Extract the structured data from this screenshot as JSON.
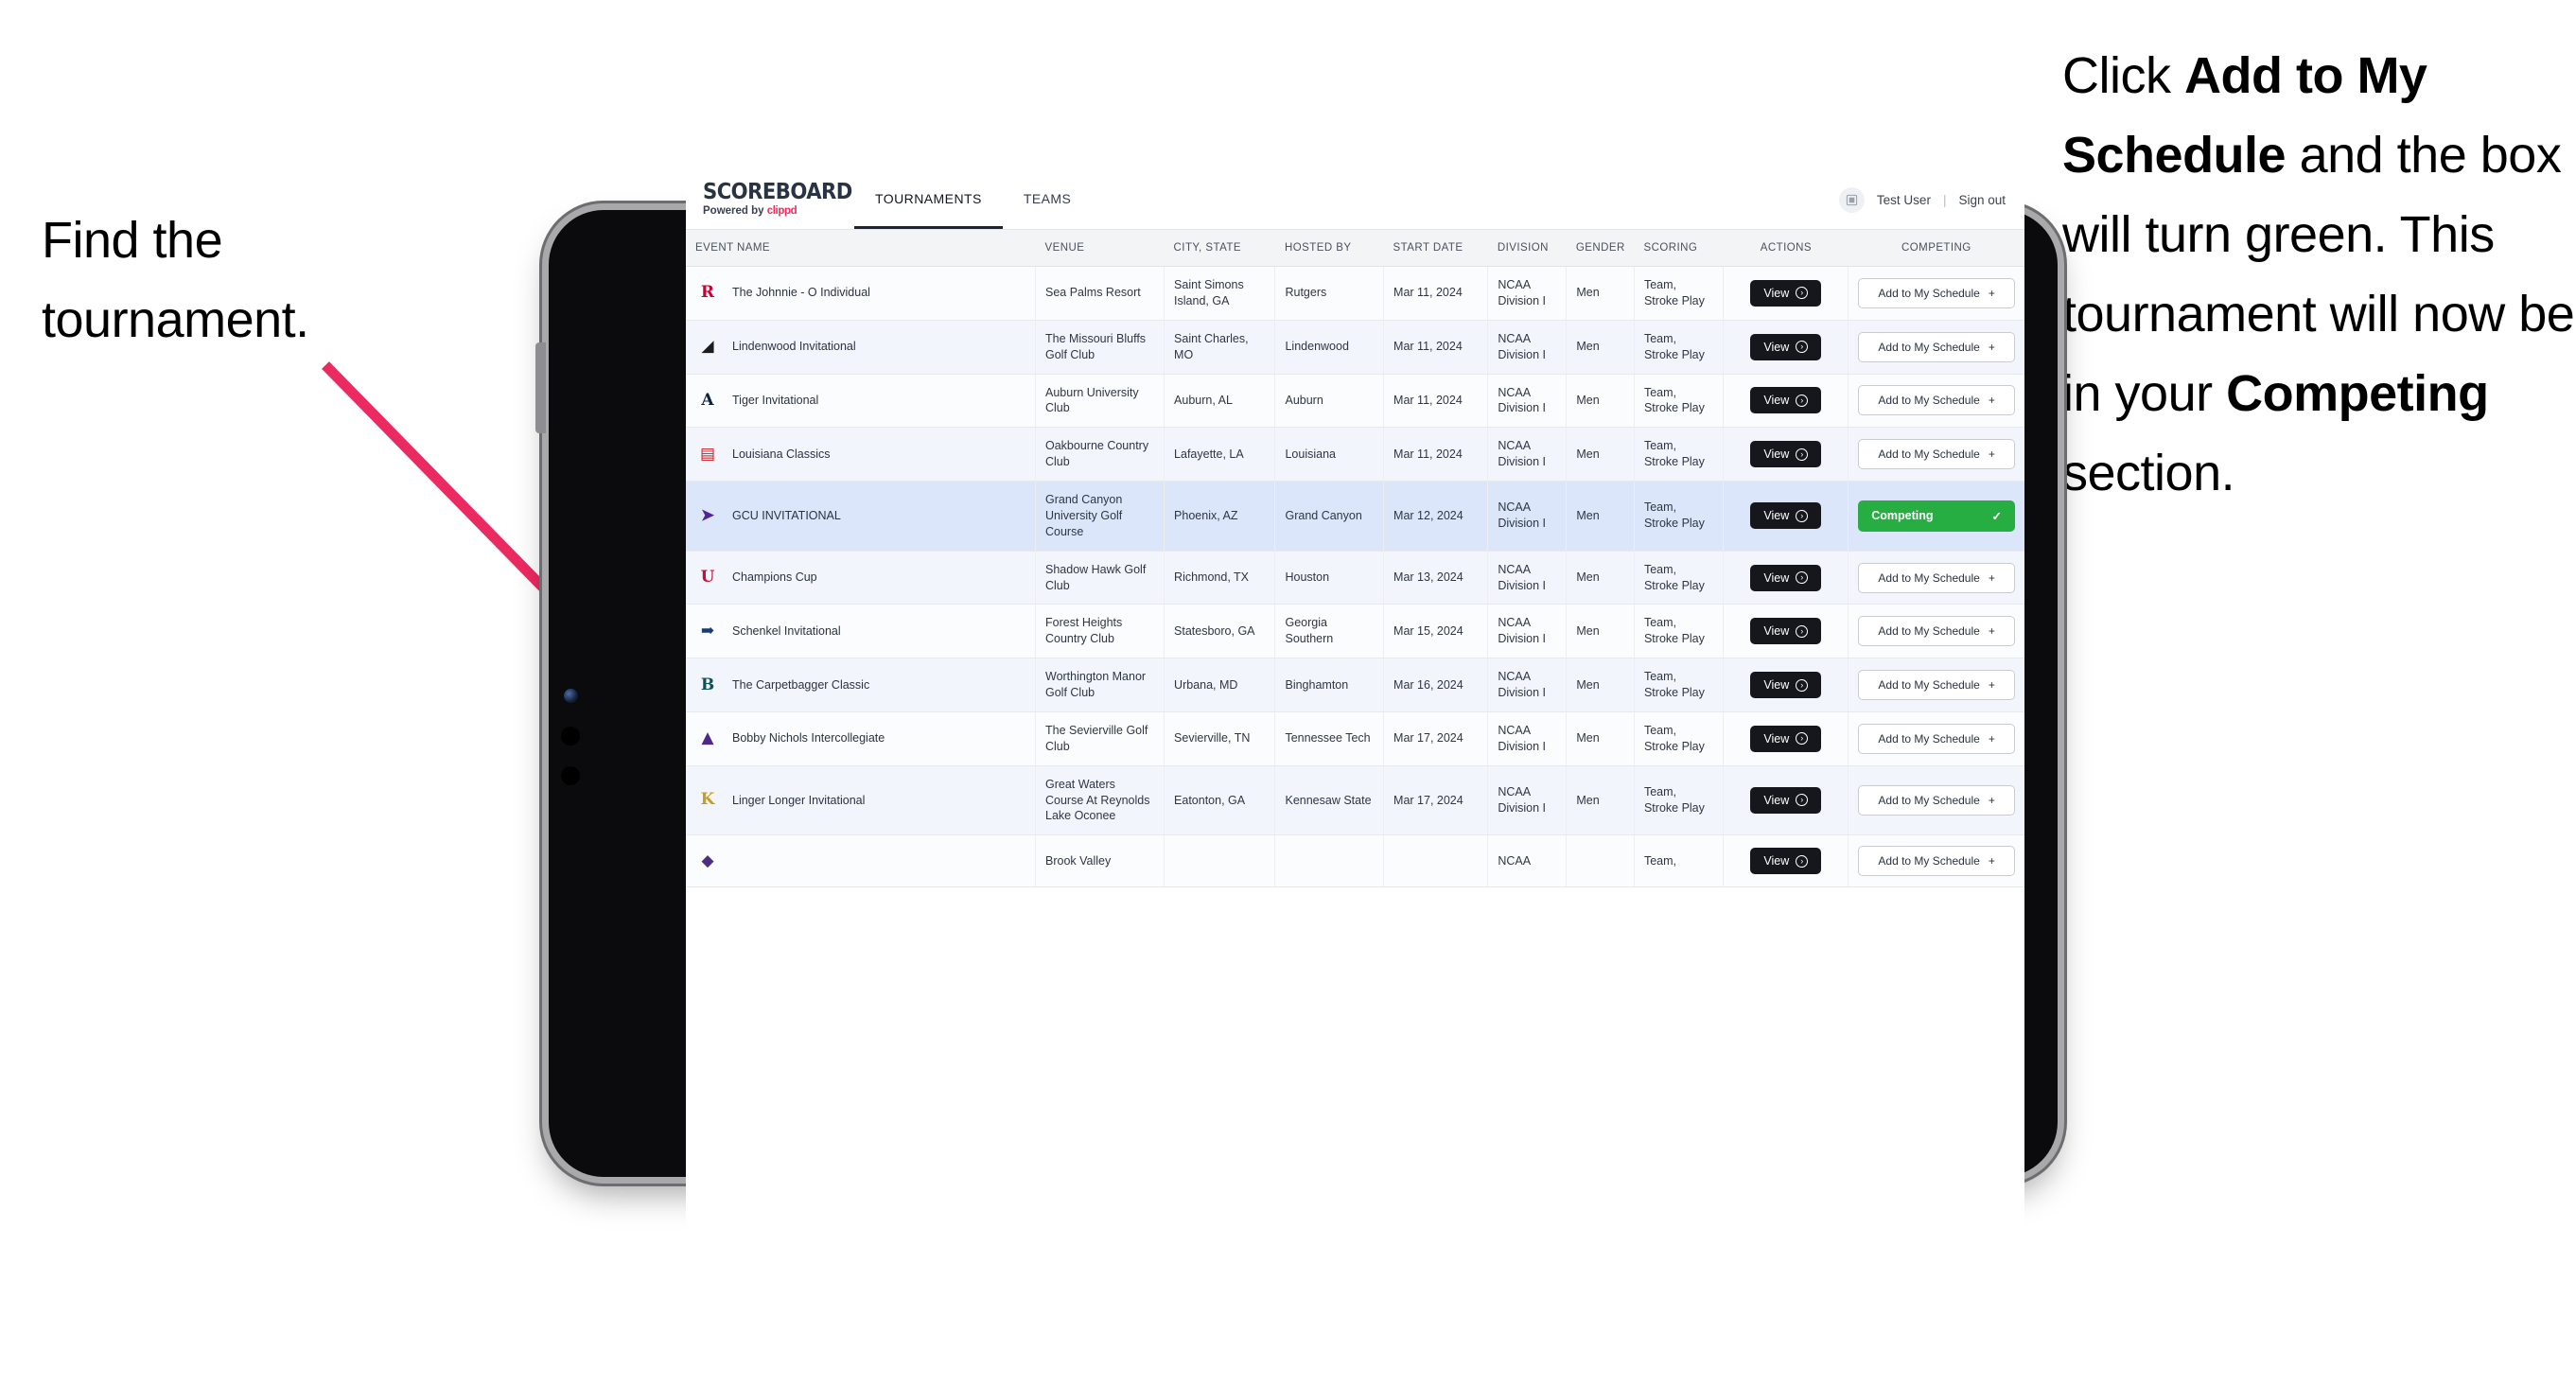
{
  "annotations": {
    "left": {
      "line1": "Find the",
      "line2": "tournament."
    },
    "right": {
      "part1": "Click ",
      "bold1": "Add to My Schedule",
      "part2": " and the box will turn green. This tournament will now be in your ",
      "bold2": "Competing",
      "part3": " section."
    },
    "arrow_color": "#ec2a62"
  },
  "app": {
    "brand": {
      "title": "SCOREBOARD",
      "powered_prefix": "Powered by ",
      "powered_brand": "clippd",
      "brand_color": "#ef2c5c"
    },
    "nav_tabs": [
      {
        "label": "TOURNAMENTS",
        "active": true
      },
      {
        "label": "TEAMS",
        "active": false
      }
    ],
    "account": {
      "avatar_icon": "user-grid-icon",
      "user_name": "Test User",
      "separator": "|",
      "sign_out": "Sign out"
    }
  },
  "table": {
    "columns": [
      "EVENT NAME",
      "VENUE",
      "CITY, STATE",
      "HOSTED BY",
      "START DATE",
      "DIVISION",
      "GENDER",
      "SCORING",
      "ACTIONS",
      "COMPETING"
    ],
    "view_label": "View",
    "add_label": "Add to My Schedule",
    "add_plus": "+",
    "competing_label": "Competing",
    "competing_check": "✓",
    "competing_color": "#27ae43",
    "rows": [
      {
        "event": "The Johnnie - O Individual",
        "logo_text": "R",
        "logo_fg": "#cc0033",
        "logo_bg": "transparent",
        "venue": "Sea Palms Resort",
        "city": "Saint Simons Island, GA",
        "host": "Rutgers",
        "date": "Mar 11, 2024",
        "division": "NCAA Division I",
        "gender": "Men",
        "scoring": "Team, Stroke Play",
        "competing": false
      },
      {
        "event": "Lindenwood Invitational",
        "logo_text": "◢",
        "logo_fg": "#1c1c1c",
        "logo_bg": "transparent",
        "venue": "The Missouri Bluffs Golf Club",
        "city": "Saint Charles, MO",
        "host": "Lindenwood",
        "date": "Mar 11, 2024",
        "division": "NCAA Division I",
        "gender": "Men",
        "scoring": "Team, Stroke Play",
        "competing": false
      },
      {
        "event": "Tiger Invitational",
        "logo_text": "A",
        "logo_fg": "#0c2340",
        "logo_bg": "transparent",
        "venue": "Auburn University Club",
        "city": "Auburn, AL",
        "host": "Auburn",
        "date": "Mar 11, 2024",
        "division": "NCAA Division I",
        "gender": "Men",
        "scoring": "Team, Stroke Play",
        "competing": false
      },
      {
        "event": "Louisiana Classics",
        "logo_text": "▤",
        "logo_fg": "#ce181e",
        "logo_bg": "transparent",
        "venue": "Oakbourne Country Club",
        "city": "Lafayette, LA",
        "host": "Louisiana",
        "date": "Mar 11, 2024",
        "division": "NCAA Division I",
        "gender": "Men",
        "scoring": "Team, Stroke Play",
        "competing": false
      },
      {
        "event": "GCU INVITATIONAL",
        "logo_text": "➤",
        "logo_fg": "#522398",
        "logo_bg": "transparent",
        "venue": "Grand Canyon University Golf Course",
        "city": "Phoenix, AZ",
        "host": "Grand Canyon",
        "date": "Mar 12, 2024",
        "division": "NCAA Division I",
        "gender": "Men",
        "scoring": "Team, Stroke Play",
        "competing": true,
        "selected": true
      },
      {
        "event": "Champions Cup",
        "logo_text": "U",
        "logo_fg": "#c8102e",
        "logo_bg": "transparent",
        "venue": "Shadow Hawk Golf Club",
        "city": "Richmond, TX",
        "host": "Houston",
        "date": "Mar 13, 2024",
        "division": "NCAA Division I",
        "gender": "Men",
        "scoring": "Team, Stroke Play",
        "competing": false
      },
      {
        "event": "Schenkel Invitational",
        "logo_text": "➡",
        "logo_fg": "#1a3c6e",
        "logo_bg": "transparent",
        "venue": "Forest Heights Country Club",
        "city": "Statesboro, GA",
        "host": "Georgia Southern",
        "date": "Mar 15, 2024",
        "division": "NCAA Division I",
        "gender": "Men",
        "scoring": "Team, Stroke Play",
        "competing": false
      },
      {
        "event": "The Carpetbagger Classic",
        "logo_text": "B",
        "logo_fg": "#0d5257",
        "logo_bg": "transparent",
        "venue": "Worthington Manor Golf Club",
        "city": "Urbana, MD",
        "host": "Binghamton",
        "date": "Mar 16, 2024",
        "division": "NCAA Division I",
        "gender": "Men",
        "scoring": "Team, Stroke Play",
        "competing": false
      },
      {
        "event": "Bobby Nichols Intercollegiate",
        "logo_text": "▲",
        "logo_fg": "#4e2a84",
        "logo_bg": "transparent",
        "venue": "The Sevierville Golf Club",
        "city": "Sevierville, TN",
        "host": "Tennessee Tech",
        "date": "Mar 17, 2024",
        "division": "NCAA Division I",
        "gender": "Men",
        "scoring": "Team, Stroke Play",
        "competing": false
      },
      {
        "event": "Linger Longer Invitational",
        "logo_text": "K",
        "logo_fg": "#c5a01d",
        "logo_bg": "transparent",
        "venue": "Great Waters Course At Reynolds Lake Oconee",
        "city": "Eatonton, GA",
        "host": "Kennesaw State",
        "date": "Mar 17, 2024",
        "division": "NCAA Division I",
        "gender": "Men",
        "scoring": "Team, Stroke Play",
        "competing": false
      },
      {
        "event": "",
        "logo_text": "◆",
        "logo_fg": "#4b2e83",
        "logo_bg": "transparent",
        "venue": "Brook Valley",
        "city": "",
        "host": "",
        "date": "",
        "division": "NCAA",
        "gender": "",
        "scoring": "Team,",
        "competing": false,
        "partial": true
      }
    ]
  }
}
